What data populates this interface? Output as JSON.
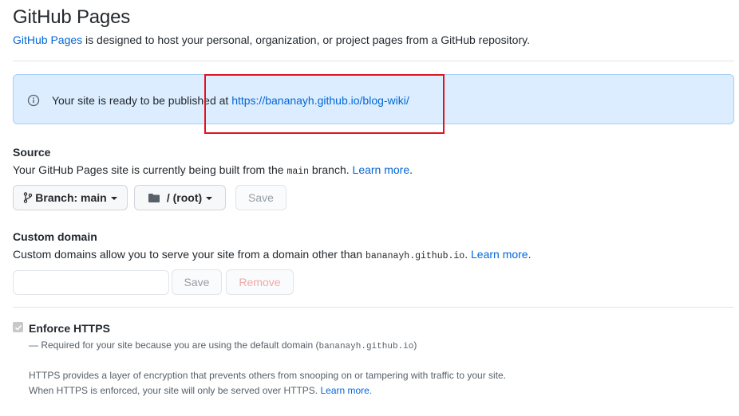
{
  "header": {
    "title": "GitHub Pages",
    "subtitle_link": "GitHub Pages",
    "subtitle_rest": " is designed to host your personal, organization, or project pages from a GitHub repository."
  },
  "flash": {
    "icon": "info-icon",
    "text": "Your site is ready to be published at ",
    "url": "https://bananayh.github.io/blog-wiki/"
  },
  "annotation": {
    "color": "#e0141e"
  },
  "source": {
    "title": "Source",
    "desc_before": "Your GitHub Pages site is currently being built from the ",
    "branch_code": "main",
    "desc_after": " branch. ",
    "learn_more": "Learn more",
    "period": ".",
    "branch_button": "Branch: main",
    "folder_button": "/ (root)",
    "save_button": "Save"
  },
  "custom_domain": {
    "title": "Custom domain",
    "desc_before": "Custom domains allow you to serve your site from a domain other than ",
    "domain_code": "bananayh.github.io",
    "desc_after": ". ",
    "learn_more": "Learn more",
    "period": ".",
    "input_value": "",
    "save_button": "Save",
    "remove_button": "Remove"
  },
  "https": {
    "title": "Enforce HTTPS",
    "checked": true,
    "required_before": "— Required for your site because you are using the default domain (",
    "required_code": "bananayh.github.io",
    "required_after": ")",
    "info_line1": "HTTPS provides a layer of encryption that prevents others from snooping on or tampering with traffic to your site.",
    "info_line2": "When HTTPS is enforced, your site will only be served over HTTPS. ",
    "learn_more": "Learn more",
    "period": "."
  },
  "colors": {
    "link": "#0366d6",
    "flash_bg": "#dbedff",
    "flash_border": "#a8cff5",
    "text": "#24292e",
    "muted": "#586069"
  }
}
